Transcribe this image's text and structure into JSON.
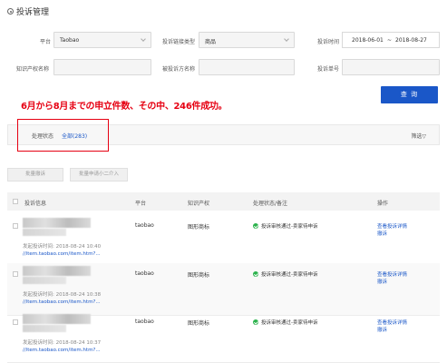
{
  "page": {
    "title": "投诉管理"
  },
  "form": {
    "platform_label": "平台",
    "platform_value": "Taobao",
    "link_type_label": "投诉链接类型",
    "link_type_value": "商品",
    "time_label": "投诉时间",
    "date_start": "2018-06-01",
    "date_sep": "~",
    "date_end": "2018-08-27",
    "ip_name_label": "知识产权名称",
    "respondent_label": "被投诉方名称",
    "complaint_no_label": "投诉单号",
    "search_label": "查 询"
  },
  "annotation": "6月から8月までの申立件数、その中、246件成功。",
  "filter": {
    "status_label": "处理状态",
    "status_value": "全部(283)",
    "filter_btn": "筛选▽"
  },
  "bulk": {
    "withdraw_label": "批量撤诉",
    "apply_label": "批量申请小二介入"
  },
  "table": {
    "headers": [
      "投诉信息",
      "平台",
      "知识产权",
      "处理状态/备注",
      "操作"
    ],
    "rows": [
      {
        "date": "发起投诉时间: 2018-08-24 10:40",
        "url": "//item.taobao.com/item.htm?...",
        "platform": "taobao",
        "ip": "图形商标",
        "status": "投诉审核通过-卖家待申诉",
        "action_view": "查看投诉详情",
        "action_withdraw": "撤诉"
      },
      {
        "date": "发起投诉时间: 2018-08-24 10:38",
        "url": "//item.taobao.com/item.htm?...",
        "platform": "taobao",
        "ip": "图形商标",
        "status": "投诉审核通过-卖家待申诉",
        "action_view": "查看投诉详情",
        "action_withdraw": "撤诉"
      },
      {
        "date": "发起投诉时间: 2018-08-24 10:37",
        "url": "//item.taobao.com/item.htm?...",
        "platform": "taobao",
        "ip": "图形商标",
        "status": "投诉审核通过-卖家待申诉",
        "action_view": "查看投诉详情",
        "action_withdraw": "撤诉"
      }
    ]
  },
  "colors": {
    "accent": "#1a57c8",
    "annotation": "#e60012",
    "success": "#2bb24c"
  }
}
